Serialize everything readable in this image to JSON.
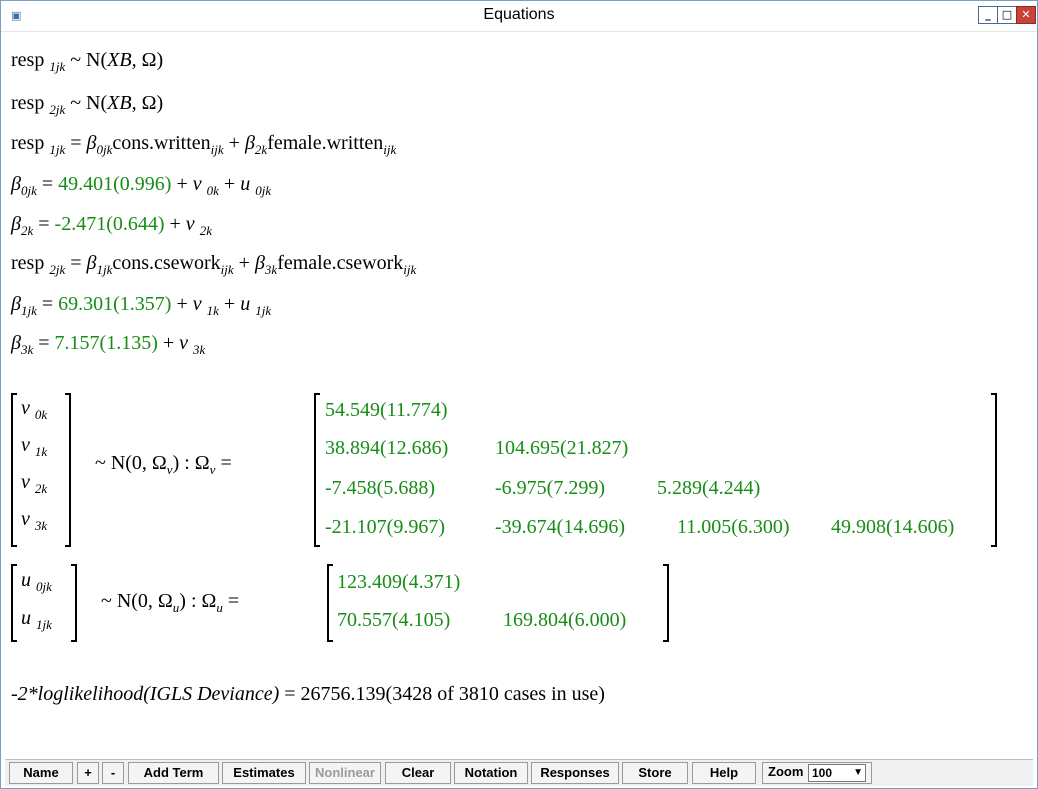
{
  "window": {
    "title": "Equations"
  },
  "equations": {
    "resp": "resp",
    "sub1": "1jk",
    "sub2": "2jk",
    "dist_text": " ~ N(",
    "xb": "XB,",
    "omega": " Ω)",
    "eq": " = ",
    "beta": "β",
    "plus": " + ",
    "cons_written": "cons.written",
    "female_written": "female.written",
    "cons_csework": "cons.csework",
    "female_csework": "female.csework",
    "ijk": "ijk",
    "b0_sub": "0jk",
    "b1_sub": "1jk",
    "b2_sub": "2k",
    "b3_sub": "3k",
    "b0_val": "49.401(0.996)",
    "b2_val": "-2.471(0.644)",
    "b1_val": "69.301(1.357)",
    "b3_val": "7.157(1.135)",
    "v": "v",
    "u": "u",
    "v0_sub": "0k",
    "v1_sub": "1k",
    "v2_sub": "2k",
    "v3_sub": "3k",
    "u0_sub": "0jk",
    "u1_sub": "1jk"
  },
  "level3": {
    "dist_prefix": "~ N(0,  Ω",
    "dist_sub": "v",
    "dist_suffix": ")  :  Ω",
    "dist_sub2": "v",
    "dist_eq": " =",
    "matrix": [
      [
        "54.549(11.774)"
      ],
      [
        "38.894(12.686)",
        "104.695(21.827)"
      ],
      [
        "-7.458(5.688)",
        "-6.975(7.299)",
        "5.289(4.244)"
      ],
      [
        "-21.107(9.967)",
        "-39.674(14.696)",
        "11.005(6.300)",
        "49.908(14.606)"
      ]
    ]
  },
  "level2": {
    "dist_prefix": "~ N(0,  Ω",
    "dist_sub": "u",
    "dist_suffix": ")  :  Ω",
    "dist_sub2": "u",
    "dist_eq": " =",
    "matrix": [
      [
        "123.409(4.371)"
      ],
      [
        "70.557(4.105)",
        "169.804(6.000)"
      ]
    ]
  },
  "deviance": {
    "label": "-2*loglikelihood(IGLS Deviance)",
    "eq": " = ",
    "value": "26756.139",
    "cases": "(3428 of 3810 cases in use)"
  },
  "toolbar": {
    "name": "Name",
    "plus": "+",
    "minus": "-",
    "add_term": "Add Term",
    "estimates": "Estimates",
    "nonlinear": "Nonlinear",
    "clear": "Clear",
    "notation": "Notation",
    "responses": "Responses",
    "store": "Store",
    "help": "Help",
    "zoom_label": "Zoom",
    "zoom_value": "100"
  },
  "colors": {
    "estimate": "#178d17"
  }
}
